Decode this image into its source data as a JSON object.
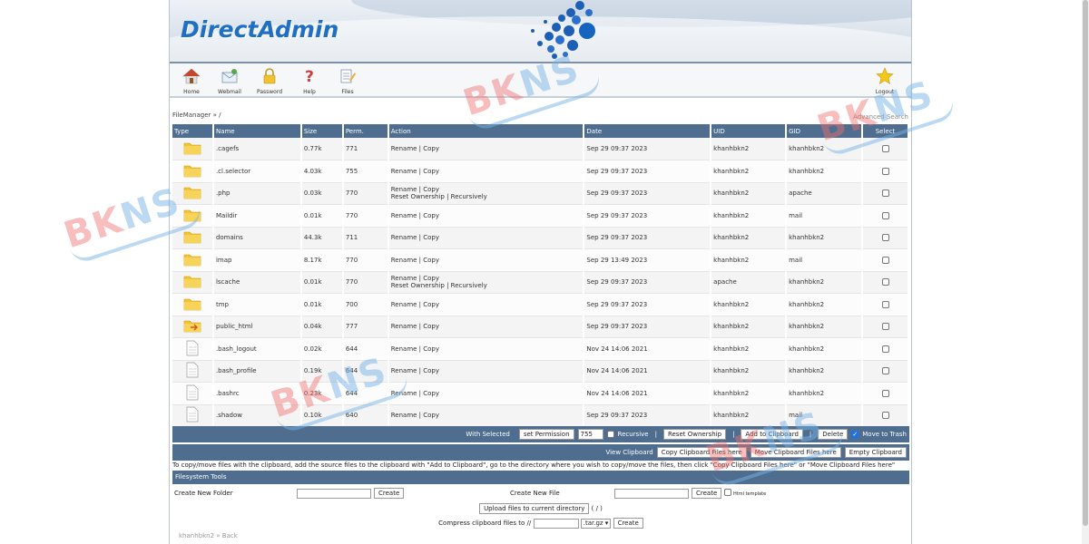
{
  "brand": {
    "logo": "DirectAdmin"
  },
  "nav": [
    {
      "label": "Home",
      "icon": "home-icon"
    },
    {
      "label": "Webmail",
      "icon": "webmail-icon"
    },
    {
      "label": "Password",
      "icon": "lock-icon"
    },
    {
      "label": "Help",
      "icon": "help-icon"
    },
    {
      "label": "Files",
      "icon": "files-icon"
    }
  ],
  "logout": {
    "label": "Logout",
    "icon": "star-icon"
  },
  "breadcrumb": "FileManager » /",
  "advanced_search": "Advanced Search",
  "table": {
    "headers": [
      "Type",
      "Name",
      "Size",
      "Perm.",
      "Action",
      "Date",
      "UID",
      "GID",
      "Select"
    ],
    "rows": [
      {
        "type": "folder",
        "name": ".cagefs",
        "size": "0.77k",
        "perm": "771",
        "action": "Rename | Copy",
        "action2": "",
        "date": "Sep 29 09:37 2023",
        "uid": "khanhbkn2",
        "gid": "khanhbkn2"
      },
      {
        "type": "folder",
        "name": ".cl.selector",
        "size": "4.03k",
        "perm": "755",
        "action": "Rename | Copy",
        "action2": "",
        "date": "Sep 29 09:37 2023",
        "uid": "khanhbkn2",
        "gid": "khanhbkn2"
      },
      {
        "type": "folder",
        "name": ".php",
        "size": "0.03k",
        "perm": "770",
        "action": "Rename | Copy",
        "action2": "Reset Ownership | Recursively",
        "date": "Sep 29 09:37 2023",
        "uid": "khanhbkn2",
        "gid": "apache"
      },
      {
        "type": "folder",
        "name": "Maildir",
        "size": "0.01k",
        "perm": "770",
        "action": "Rename | Copy",
        "action2": "",
        "date": "Sep 29 09:37 2023",
        "uid": "khanhbkn2",
        "gid": "mail"
      },
      {
        "type": "folder",
        "name": "domains",
        "size": "44.3k",
        "perm": "711",
        "action": "Rename | Copy",
        "action2": "",
        "date": "Sep 29 09:37 2023",
        "uid": "khanhbkn2",
        "gid": "khanhbkn2"
      },
      {
        "type": "folder",
        "name": "imap",
        "size": "8.17k",
        "perm": "770",
        "action": "Rename | Copy",
        "action2": "",
        "date": "Sep 29 13:49 2023",
        "uid": "khanhbkn2",
        "gid": "mail"
      },
      {
        "type": "folder",
        "name": "lscache",
        "size": "0.01k",
        "perm": "770",
        "action": "Rename | Copy",
        "action2": "Reset Ownership | Recursively",
        "date": "Sep 29 09:37 2023",
        "uid": "apache",
        "gid": "khanhbkn2"
      },
      {
        "type": "folder",
        "name": "tmp",
        "size": "0.01k",
        "perm": "700",
        "action": "Rename | Copy",
        "action2": "",
        "date": "Sep 29 09:37 2023",
        "uid": "khanhbkn2",
        "gid": "khanhbkn2"
      },
      {
        "type": "folder-link",
        "name": "public_html",
        "size": "0.04k",
        "perm": "777",
        "action": "Rename | Copy",
        "action2": "",
        "date": "Sep 29 09:37 2023",
        "uid": "khanhbkn2",
        "gid": "khanhbkn2"
      },
      {
        "type": "file",
        "name": ".bash_logout",
        "size": "0.02k",
        "perm": "644",
        "action": "Rename | Copy",
        "action2": "",
        "date": "Nov 24 14:06 2021",
        "uid": "khanhbkn2",
        "gid": "khanhbkn2"
      },
      {
        "type": "file",
        "name": ".bash_profile",
        "size": "0.19k",
        "perm": "644",
        "action": "Rename | Copy",
        "action2": "",
        "date": "Nov 24 14:06 2021",
        "uid": "khanhbkn2",
        "gid": "khanhbkn2"
      },
      {
        "type": "file",
        "name": ".bashrc",
        "size": "0.23k",
        "perm": "644",
        "action": "Rename | Copy",
        "action2": "",
        "date": "Nov 24 14:06 2021",
        "uid": "khanhbkn2",
        "gid": "khanhbkn2"
      },
      {
        "type": "file",
        "name": ".shadow",
        "size": "0.10k",
        "perm": "640",
        "action": "Rename | Copy",
        "action2": "",
        "date": "Sep 29 09:37 2023",
        "uid": "khanhbkn2",
        "gid": "mail"
      }
    ]
  },
  "selected_bar": {
    "with_selected": "With Selected",
    "set_permission": "set Permission",
    "permission_value": "755",
    "recursive": "Recursive",
    "reset_ownership": "Reset Ownership",
    "add_to_clipboard": "Add to Clipboard",
    "delete": "Delete",
    "move_to_trash": "Move to Trash"
  },
  "clipboard_bar": {
    "view_clipboard": "View Clipboard",
    "copy_here": "Copy Clipboard Files here",
    "move_here": "Move Clipboard Files here",
    "empty": "Empty Clipboard"
  },
  "help_text": "To copy/move files with the clipboard, add the source files to the clipboard with \"Add to Clipboard\", go to the directory where you wish to copy/move the files, then click \"Copy Clipboard Files here\" or \"Move Clipboard Files here\"",
  "filesystem_tools": {
    "title": "Filesystem Tools",
    "create_folder_label": "Create New Folder",
    "create_button": "Create",
    "create_file_label": "Create New File",
    "create_file_button": "Create",
    "html_template": "Html template",
    "upload_button": "Upload files to current directory",
    "upload_path": "( / )",
    "compress_label": "Compress clipboard files to //",
    "compress_ext": ".tar.gz",
    "compress_button": "Create"
  },
  "footer": "khanhbkn2 » Back",
  "watermark": {
    "text_red": "BK",
    "text_blue": "NS"
  },
  "colors": {
    "header_bar": "#4f6d8f",
    "logo": "#1f6fc4",
    "folder": "#f4c430"
  }
}
